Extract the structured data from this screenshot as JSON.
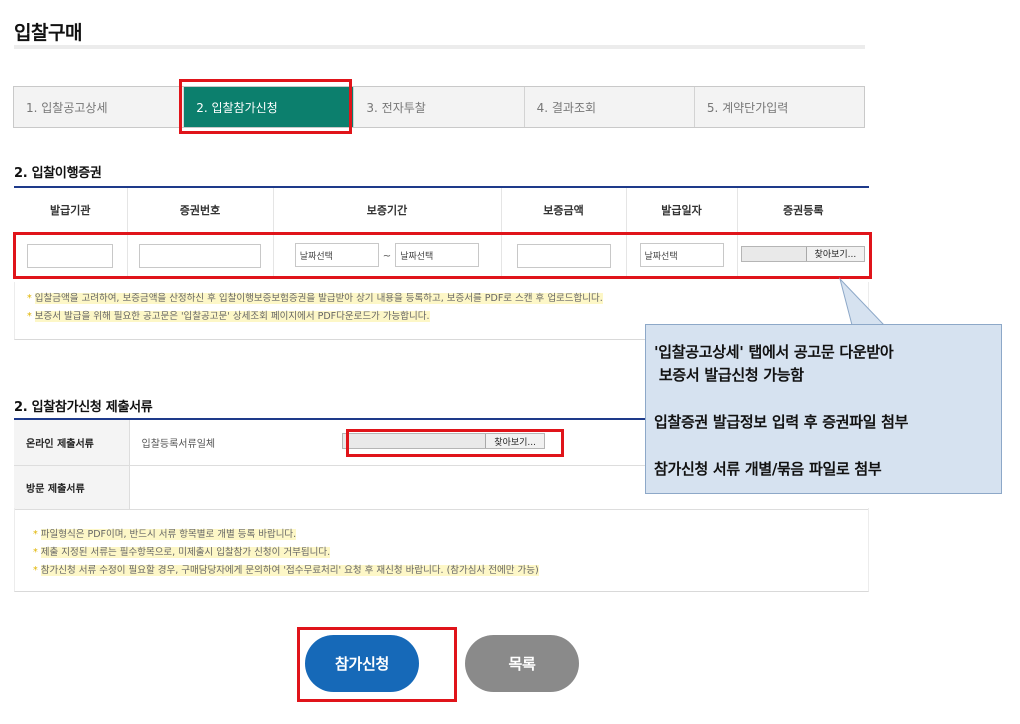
{
  "page_title": "입찰구매",
  "steps": [
    {
      "label": "1. 입찰공고상세"
    },
    {
      "label": "2. 입찰참가신청"
    },
    {
      "label": "3. 전자투찰"
    },
    {
      "label": "4. 결과조회"
    },
    {
      "label": "5. 계약단가입력"
    }
  ],
  "active_step": 1,
  "bond_section": {
    "title": "2. 입찰이행증권",
    "columns": [
      "발급기관",
      "증권번호",
      "보증기간",
      "보증금액",
      "발급일자",
      "증권등록"
    ],
    "date_placeholder": "날짜선택",
    "tilde": "~",
    "browse_label": "찾아보기...",
    "notes": [
      "입찰금액을 고려하여, 보증금액을 산정하신 후 입찰이행보증보험증권을 발급받아 상기 내용을 등록하고, 보증서를 PDF로 스캔 후 업로드합니다.",
      "보증서 발급을 위해 필요한 공고문은 '입찰공고문' 상세조회 페이지에서 PDF다운로드가 가능합니다."
    ]
  },
  "docs_section": {
    "title": "2. 입찰참가신청 제출서류",
    "rows": [
      {
        "label": "온라인 제출서류",
        "value": "입찰등록서류일체"
      },
      {
        "label": "방문 제출서류",
        "value": ""
      }
    ],
    "browse_label": "찾아보기...",
    "notes": [
      "파일형식은 PDF이며, 반드시 서류 항목별로 개별 등록 바랍니다.",
      "제출 지정된 서류는 필수항목으로, 미제출시 입찰참가 신청이 거부됩니다.",
      "참가신청 서류 수정이 필요할 경우, 구매담당자에게 문의하여 '접수무료처리' 요청 후 재신청 바랍니다. (참가심사 전에만 가능)"
    ]
  },
  "callout": {
    "lines": [
      "'입찰공고상세' 탭에서 공고문 다운받아",
      " 보증서 발급신청 가능함",
      "입찰증권 발급정보 입력 후 증권파일 첨부",
      "참가신청 서류 개별/묶음 파일로 첨부"
    ]
  },
  "buttons": {
    "apply": "참가신청",
    "list": "목록"
  },
  "colors": {
    "active_step": "#0c7f6d",
    "highlight": "#e0141a",
    "table_top_border": "#1e3a8a",
    "apply_button": "#1669b8",
    "list_button": "#8a8a8a",
    "callout_bg": "#d6e2f0"
  }
}
